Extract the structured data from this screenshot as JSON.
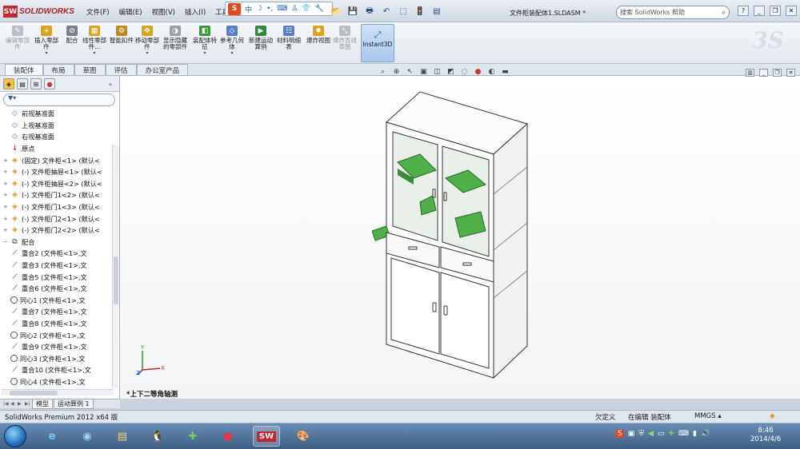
{
  "app": {
    "logo_text": "SOLIDWORKS",
    "logo_badge": "SW",
    "document_title": "文件柜装配体1.SLDASM *"
  },
  "menu": [
    "文件(F)",
    "编辑(E)",
    "视图(V)",
    "插入(I)",
    "工具"
  ],
  "ime_bar": {
    "label": "S",
    "mode": "中"
  },
  "search": {
    "placeholder": "搜索 SolidWorks 帮助"
  },
  "ribbon": {
    "buttons": [
      {
        "label": "编辑零部件",
        "disabled": true,
        "icon": "edit-component-icon"
      },
      {
        "label": "插入零部件",
        "disabled": false,
        "icon": "insert-component-icon"
      },
      {
        "label": "配合",
        "disabled": false,
        "icon": "mate-icon"
      },
      {
        "label": "线性零部件...",
        "disabled": false,
        "icon": "linear-pattern-icon"
      },
      {
        "label": "智能扣件",
        "disabled": false,
        "icon": "smart-fastener-icon"
      },
      {
        "label": "移动零部件",
        "disabled": false,
        "icon": "move-component-icon"
      },
      {
        "label": "显示隐藏的零部件",
        "disabled": false,
        "icon": "show-hidden-icon"
      },
      {
        "label": "装配体特征",
        "disabled": false,
        "icon": "assembly-feature-icon"
      },
      {
        "label": "参考几何体",
        "disabled": false,
        "icon": "reference-geometry-icon"
      },
      {
        "label": "新建运动算例",
        "disabled": false,
        "icon": "motion-study-icon"
      },
      {
        "label": "材料明细表",
        "disabled": false,
        "icon": "bom-icon"
      },
      {
        "label": "爆炸视图",
        "disabled": false,
        "icon": "explode-icon"
      },
      {
        "label": "爆炸直线草图",
        "disabled": true,
        "icon": "explode-line-icon"
      }
    ],
    "instant3d": "Instant3D"
  },
  "tabs": [
    "装配体",
    "布局",
    "草图",
    "评估",
    "办公室产品"
  ],
  "tree": [
    {
      "label": "前视基准面",
      "icon": "plane",
      "exp": ""
    },
    {
      "label": "上视基准面",
      "icon": "plane",
      "exp": ""
    },
    {
      "label": "右视基准面",
      "icon": "plane",
      "exp": ""
    },
    {
      "label": "原点",
      "icon": "origin",
      "exp": ""
    },
    {
      "label": "(固定) 文件柜<1> (默认<",
      "icon": "part",
      "exp": "+"
    },
    {
      "label": "(-) 文件柜抽屉<1> (默认<",
      "icon": "part",
      "exp": "+"
    },
    {
      "label": "(-) 文件柜抽屉<2> (默认<",
      "icon": "part",
      "exp": "+"
    },
    {
      "label": "(-) 文件柜门1<2> (默认<",
      "icon": "part",
      "exp": "+"
    },
    {
      "label": "(-) 文件柜门1<3> (默认<",
      "icon": "part",
      "exp": "+"
    },
    {
      "label": "(-) 文件柜门2<1> (默认<",
      "icon": "part",
      "exp": "+"
    },
    {
      "label": "(-) 文件柜门2<2> (默认<",
      "icon": "part",
      "exp": "+"
    },
    {
      "label": "配合",
      "icon": "mate",
      "exp": "−"
    },
    {
      "label": "重合2 (文件柜<1>,文",
      "icon": "coinc",
      "exp": ""
    },
    {
      "label": "重合3 (文件柜<1>,文",
      "icon": "coinc",
      "exp": ""
    },
    {
      "label": "重合5 (文件柜<1>,文",
      "icon": "coinc",
      "exp": ""
    },
    {
      "label": "重合6 (文件柜<1>,文",
      "icon": "coinc",
      "exp": ""
    },
    {
      "label": "同心1 (文件柜<1>,文",
      "icon": "conc",
      "exp": ""
    },
    {
      "label": "重合7 (文件柜<1>,文",
      "icon": "coinc",
      "exp": ""
    },
    {
      "label": "重合8 (文件柜<1>,文",
      "icon": "coinc",
      "exp": ""
    },
    {
      "label": "同心2 (文件柜<1>,文",
      "icon": "conc",
      "exp": ""
    },
    {
      "label": "重合9 (文件柜<1>,文",
      "icon": "coinc",
      "exp": ""
    },
    {
      "label": "同心3 (文件柜<1>,文",
      "icon": "conc",
      "exp": ""
    },
    {
      "label": "重合10 (文件柜<1>,文",
      "icon": "coinc",
      "exp": ""
    },
    {
      "label": "同心4 (文件柜<1>,文",
      "icon": "conc",
      "exp": ""
    }
  ],
  "viewport": {
    "view_name": "*上下二等角轴测",
    "triad": {
      "x": "X",
      "y": "Y",
      "z": "Z"
    }
  },
  "bottom_tabs": [
    "模型",
    "运动算例 1"
  ],
  "status": {
    "product": "SolidWorks Premium 2012 x64 版",
    "state": "欠定义",
    "editing": "在编辑 装配体",
    "units": "MMGS ▴"
  },
  "taskbar": {
    "time": "8:46",
    "date": "2014/4/6"
  },
  "colors": {
    "shelf_green": "#4fb04a",
    "brand_red": "#c1272d"
  }
}
